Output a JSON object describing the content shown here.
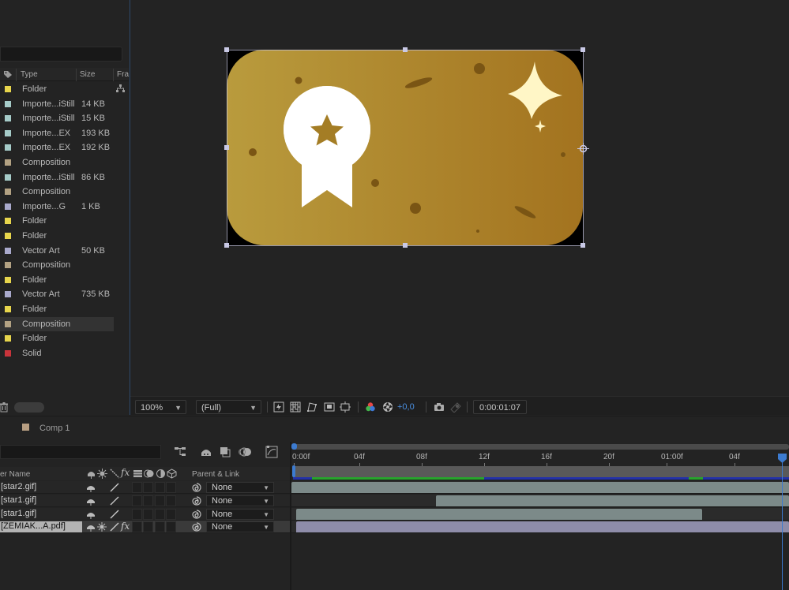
{
  "project": {
    "columns": {
      "type": "Type",
      "size": "Size",
      "frame": "Fra"
    },
    "items": [
      {
        "type": "Folder",
        "size": "",
        "color": "#e7d54c"
      },
      {
        "type": "Importe...iStill",
        "size": "14 KB",
        "color": "#a6ccc9"
      },
      {
        "type": "Importe...iStill",
        "size": "15 KB",
        "color": "#a6ccc9"
      },
      {
        "type": "Importe...EX",
        "size": "193 KB",
        "color": "#a6ccc9"
      },
      {
        "type": "Importe...EX",
        "size": "192 KB",
        "color": "#a6ccc9"
      },
      {
        "type": "Composition",
        "size": "",
        "color": "#b3a283"
      },
      {
        "type": "Importe...iStill",
        "size": "86 KB",
        "color": "#a6ccc9"
      },
      {
        "type": "Composition",
        "size": "",
        "color": "#b3a283"
      },
      {
        "type": "Importe...G",
        "size": "1 KB",
        "color": "#a9a9cc"
      },
      {
        "type": "Folder",
        "size": "",
        "color": "#e7d54c"
      },
      {
        "type": "Folder",
        "size": "",
        "color": "#e7d54c"
      },
      {
        "type": "Vector Art",
        "size": "50 KB",
        "color": "#a9a9cc"
      },
      {
        "type": "Composition",
        "size": "",
        "color": "#b3a283"
      },
      {
        "type": "Folder",
        "size": "",
        "color": "#e7d54c"
      },
      {
        "type": "Vector Art",
        "size": "735 KB",
        "color": "#a9a9cc"
      },
      {
        "type": "Folder",
        "size": "",
        "color": "#e7d54c"
      },
      {
        "type": "Composition",
        "size": "",
        "color": "#b3a283",
        "selected": true
      },
      {
        "type": "Folder",
        "size": "",
        "color": "#e7d54c"
      },
      {
        "type": "Solid",
        "size": "",
        "color": "#c9343b"
      }
    ]
  },
  "viewer": {
    "zoom": "100%",
    "resolution": "(Full)",
    "exposure": "+0,0",
    "timecode": "0:00:01:07"
  },
  "timeline": {
    "comp_tab": "Comp 1",
    "layer_name_header": "er Name",
    "parent_header": "Parent & Link",
    "ruler_labels": [
      "0:00f",
      "04f",
      "08f",
      "12f",
      "16f",
      "20f",
      "01:00f",
      "04f"
    ],
    "layers": [
      {
        "name": "[star2.gif]",
        "parent": "None",
        "has_fx": false,
        "selected": false,
        "bar_color": "#7c8a89",
        "bar_start_frac": 0.0,
        "bar_end_frac": 1.0
      },
      {
        "name": "[star1.gif]",
        "parent": "None",
        "has_fx": false,
        "selected": false,
        "bar_color": "#7c8a89",
        "bar_start_frac": 0.29,
        "bar_end_frac": 1.0
      },
      {
        "name": "[star1.gif]",
        "parent": "None",
        "has_fx": false,
        "selected": false,
        "bar_color": "#7c8a89",
        "bar_start_frac": 0.01,
        "bar_end_frac": 0.825
      },
      {
        "name": "[ZEMIAK...A.pdf]",
        "parent": "None",
        "has_fx": true,
        "selected": true,
        "bar_color": "#8e8ca9",
        "bar_start_frac": 0.01,
        "bar_end_frac": 1.0
      }
    ]
  },
  "colors": {
    "accent": "#3c7bd0",
    "badge_gradient_start": "#b99a3c",
    "badge_gradient_end": "#a2731f",
    "cache_green": "#27a42c",
    "cache_blue": "#2331a8"
  }
}
